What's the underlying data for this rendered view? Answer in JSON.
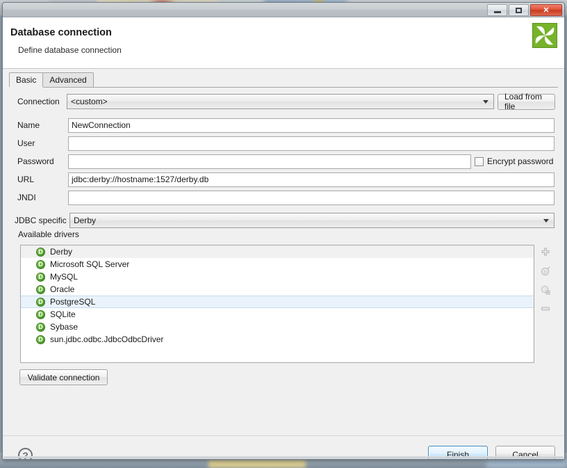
{
  "window": {
    "controls": {
      "minimize": "minimize",
      "maximize": "maximize",
      "close": "✕"
    }
  },
  "header": {
    "title": "Database connection",
    "subtitle": "Define database connection",
    "logo_color": "#77b32a"
  },
  "tabs": [
    {
      "label": "Basic",
      "active": true
    },
    {
      "label": "Advanced",
      "active": false
    }
  ],
  "form": {
    "connection": {
      "label": "Connection",
      "value": "<custom>",
      "load_button": "Load from file"
    },
    "name": {
      "label": "Name",
      "value": "NewConnection",
      "placeholder": ""
    },
    "user": {
      "label": "User",
      "value": "",
      "placeholder": ""
    },
    "password": {
      "label": "Password",
      "value": "",
      "placeholder": ""
    },
    "encrypt": {
      "label": "Encrypt password",
      "checked": false
    },
    "url": {
      "label": "URL",
      "value": "jdbc:derby://hostname:1527/derby.db",
      "placeholder": ""
    },
    "jndi": {
      "label": "JNDI",
      "value": "",
      "placeholder": ""
    },
    "jdbc_specific": {
      "label": "JDBC specific",
      "value": "Derby"
    }
  },
  "drivers": {
    "label": "Available drivers",
    "icon_letter": "D",
    "selected": "PostgreSQL",
    "items": [
      {
        "label": "Derby",
        "state": "band"
      },
      {
        "label": "Microsoft SQL Server",
        "state": "normal"
      },
      {
        "label": "MySQL",
        "state": "normal"
      },
      {
        "label": "Oracle",
        "state": "normal"
      },
      {
        "label": "PostgreSQL",
        "state": "selected"
      },
      {
        "label": "SQLite",
        "state": "normal"
      },
      {
        "label": "Sybase",
        "state": "normal"
      },
      {
        "label": "sun.jdbc.odbc.JdbcOdbcDriver",
        "state": "normal"
      }
    ],
    "tools": [
      {
        "name": "add-driver-icon",
        "glyph": "✚"
      },
      {
        "name": "edit-driver-icon",
        "glyph": "⊙"
      },
      {
        "name": "duplicate-driver-icon",
        "glyph": "⚇"
      },
      {
        "name": "remove-driver-icon",
        "glyph": "▬"
      }
    ]
  },
  "validate": {
    "label": "Validate connection"
  },
  "footer": {
    "help": "?",
    "finish": "Finish",
    "cancel": "Cancel"
  }
}
